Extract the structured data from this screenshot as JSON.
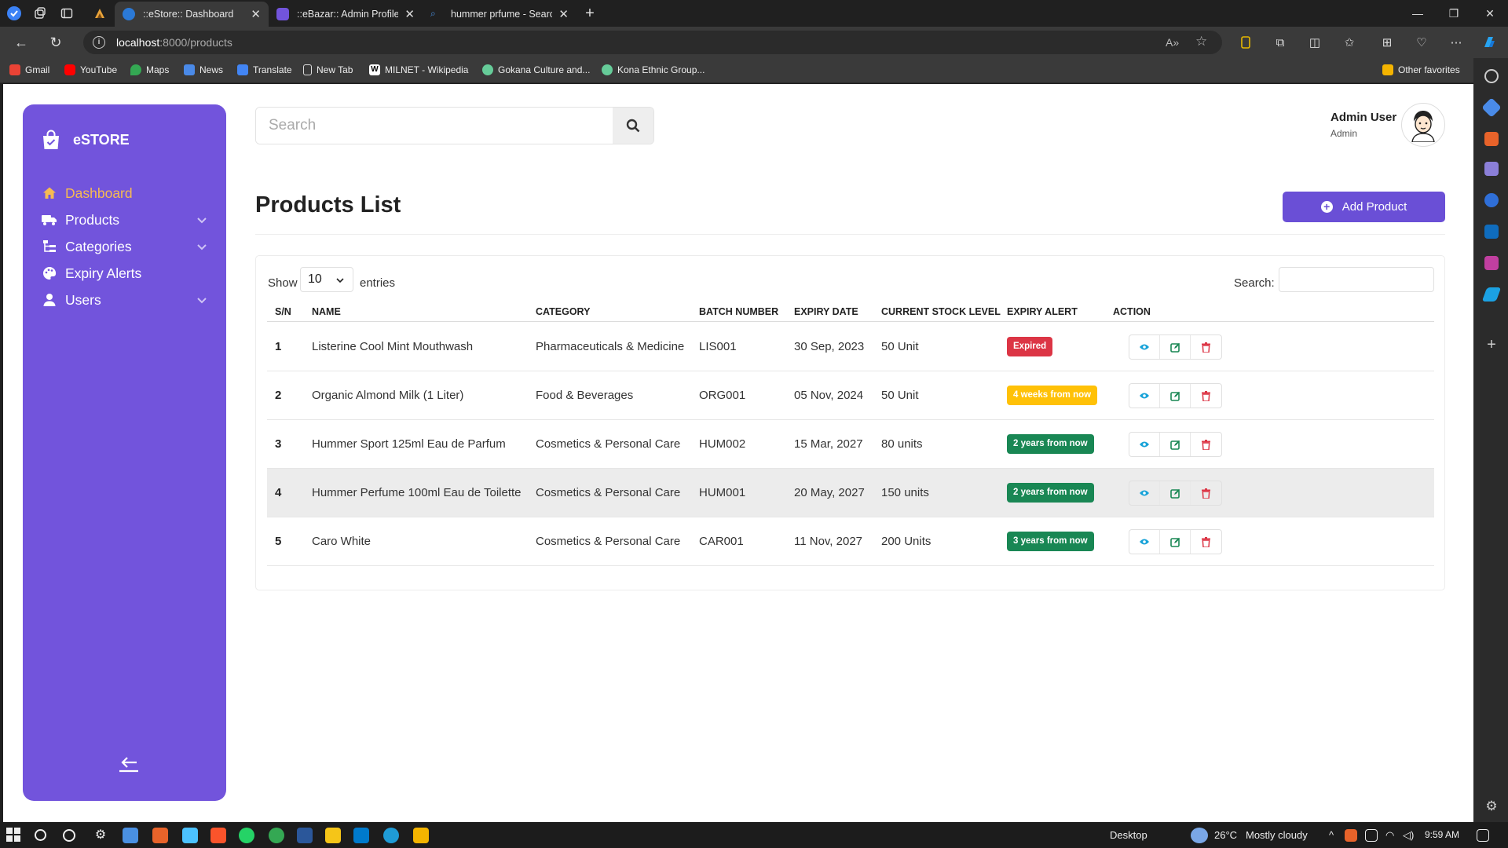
{
  "browser": {
    "tabs": [
      {
        "title": "::eStore:: Dashboard",
        "active": true
      },
      {
        "title": "::eBazar:: Admin Profile",
        "active": false
      },
      {
        "title": "hummer prfume - Search",
        "active": false
      }
    ],
    "url_host": "localhost",
    "url_path": ":8000/products",
    "bookmarks": [
      "Gmail",
      "YouTube",
      "Maps",
      "News",
      "Translate",
      "New Tab",
      "MILNET - Wikipedia",
      "Gokana Culture and...",
      "Kona Ethnic Group..."
    ],
    "other_favorites": "Other favorites"
  },
  "sidebar": {
    "brand": "eSTORE",
    "items": [
      {
        "label": "Dashboard",
        "icon": "home-icon"
      },
      {
        "label": "Products",
        "icon": "truck-icon"
      },
      {
        "label": "Categories",
        "icon": "sitemap-icon"
      },
      {
        "label": "Expiry Alerts",
        "icon": "palette-icon"
      },
      {
        "label": "Users",
        "icon": "user-icon"
      }
    ]
  },
  "header": {
    "search_placeholder": "Search",
    "user_name": "Admin User",
    "user_role": "Admin"
  },
  "main": {
    "title": "Products List",
    "add_button": "Add Product",
    "show_label": "Show",
    "entries_value": "10",
    "entries_label": "entries",
    "search_label": "Search:",
    "columns": [
      "S/N",
      "NAME",
      "CATEGORY",
      "BATCH NUMBER",
      "EXPIRY DATE",
      "CURRENT STOCK LEVEL",
      "EXPIRY ALERT",
      "ACTION"
    ],
    "rows": [
      {
        "sn": "1",
        "name": "Listerine Cool Mint Mouthwash",
        "category": "Pharmaceuticals & Medicine",
        "batch": "LIS001",
        "expiry": "30 Sep, 2023",
        "stock": "50 Unit",
        "alert": "Expired",
        "alert_color": "#dc3545"
      },
      {
        "sn": "2",
        "name": "Organic Almond Milk (1 Liter)",
        "category": "Food & Beverages",
        "batch": "ORG001",
        "expiry": "05 Nov, 2024",
        "stock": "50 Unit",
        "alert": "4 weeks from now",
        "alert_color": "#ffc107"
      },
      {
        "sn": "3",
        "name": "Hummer Sport 125ml Eau de Parfum",
        "category": "Cosmetics & Personal Care",
        "batch": "HUM002",
        "expiry": "15 Mar, 2027",
        "stock": "80 units",
        "alert": "2 years from now",
        "alert_color": "#198754"
      },
      {
        "sn": "4",
        "name": "Hummer Perfume 100ml Eau de Toilette",
        "category": "Cosmetics & Personal Care",
        "batch": "HUM001",
        "expiry": "20 May, 2027",
        "stock": "150 units",
        "alert": "2 years from now",
        "alert_color": "#198754"
      },
      {
        "sn": "5",
        "name": "Caro White",
        "category": "Cosmetics & Personal Care",
        "batch": "CAR001",
        "expiry": "11 Nov, 2027",
        "stock": "200 Units",
        "alert": "3 years from now",
        "alert_color": "#198754"
      }
    ]
  },
  "taskbar": {
    "desktop_label": "Desktop",
    "weather": "26°C",
    "weather_desc": "Mostly cloudy",
    "time": "9:59 AM"
  },
  "colors": {
    "sidebar": "#7254dc",
    "accent": "#6a4fd6",
    "active_menu": "#f6ba52",
    "view_icon": "#17a2d8",
    "edit_icon": "#198754",
    "delete_icon": "#dc3545"
  }
}
